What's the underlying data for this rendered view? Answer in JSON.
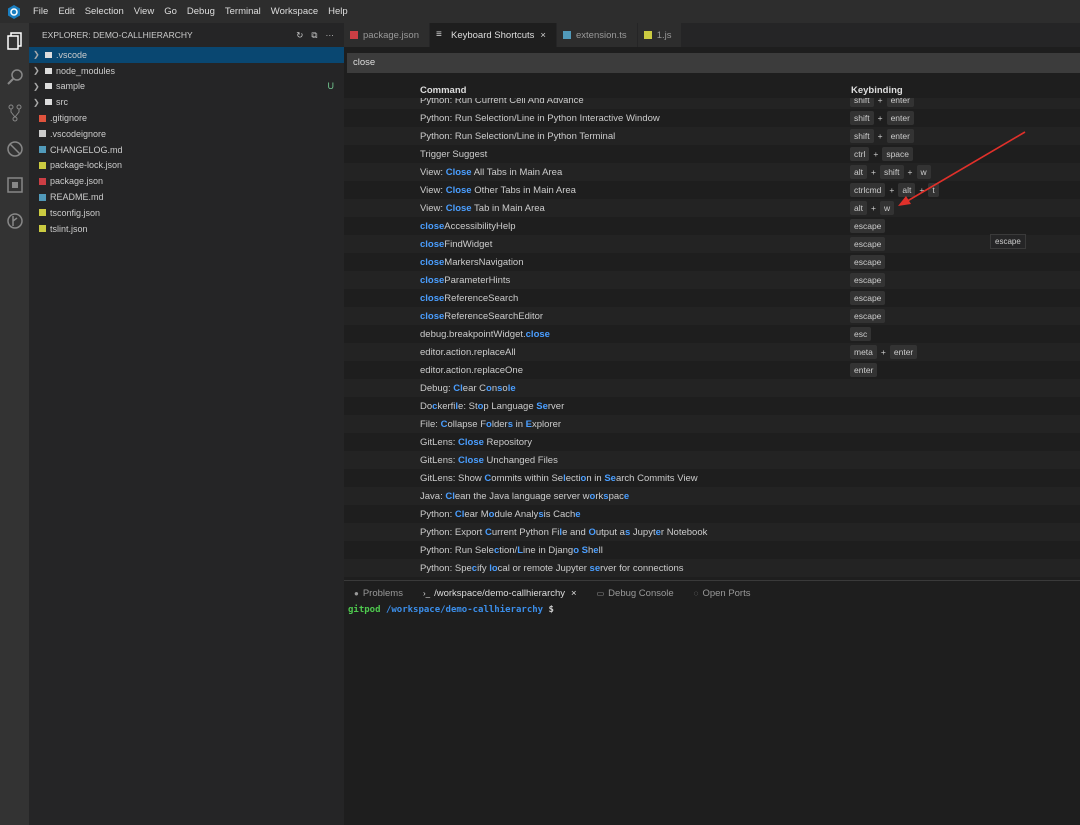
{
  "menubar": {
    "items": [
      "File",
      "Edit",
      "Selection",
      "View",
      "Go",
      "Debug",
      "Terminal",
      "Workspace",
      "Help"
    ]
  },
  "activity_bar": {
    "icons": [
      "files-icon",
      "search-icon",
      "source-control-icon",
      "debug-icon",
      "extensions-icon",
      "gitlens-icon"
    ]
  },
  "sidebar": {
    "title": "EXPLORER: DEMO-CALLHIERARCHY",
    "items": [
      {
        "label": ".vscode",
        "type": "folder",
        "selected": true
      },
      {
        "label": "node_modules",
        "type": "folder"
      },
      {
        "label": "sample",
        "type": "folder",
        "badge": "U"
      },
      {
        "label": "src",
        "type": "folder"
      },
      {
        "label": ".gitignore",
        "type": "git",
        "color": "#e0533d"
      },
      {
        "label": ".vscodeignore",
        "type": "gear",
        "color": "#cccccc"
      },
      {
        "label": "CHANGELOG.md",
        "type": "md",
        "color": "#519aba"
      },
      {
        "label": "package-lock.json",
        "type": "json",
        "color": "#cbcb41"
      },
      {
        "label": "package.json",
        "type": "npm",
        "color": "#cc3e44"
      },
      {
        "label": "README.md",
        "type": "md",
        "color": "#519aba"
      },
      {
        "label": "tsconfig.json",
        "type": "json",
        "color": "#cbcb41"
      },
      {
        "label": "tslint.json",
        "type": "json",
        "color": "#cbcb41"
      }
    ]
  },
  "tabs": [
    {
      "label": "package.json",
      "icon": "npm-icon",
      "color": "#cc3e44"
    },
    {
      "label": "Keyboard Shortcuts",
      "icon": "list-icon",
      "active": true,
      "close": "×"
    },
    {
      "label": "extension.ts",
      "icon": "typescript-icon",
      "color": "#519aba"
    },
    {
      "label": "1.js",
      "icon": "javascript-icon",
      "color": "#cbcb41"
    }
  ],
  "search": {
    "value": "close"
  },
  "table": {
    "headers": {
      "command": "Command",
      "keybinding": "Keybinding"
    },
    "rows": [
      {
        "cmd": [
          [
            "Python: Run Current Cell And Advance",
            0
          ]
        ],
        "keys": [
          "shift",
          "enter"
        ]
      },
      {
        "cmd": [
          [
            "Python: Run Selection/Line in Python Interactive Window",
            0
          ]
        ],
        "keys": [
          "shift",
          "enter"
        ]
      },
      {
        "cmd": [
          [
            "Python: Run Selection/Line in Python Terminal",
            0
          ]
        ],
        "keys": [
          "shift",
          "enter"
        ]
      },
      {
        "cmd": [
          [
            "Trigger Suggest",
            0
          ]
        ],
        "keys": [
          "ctrl",
          "space"
        ]
      },
      {
        "cmd": [
          [
            "View: ",
            0
          ],
          [
            "Close",
            1
          ],
          [
            " All Tabs in Main Area",
            0
          ]
        ],
        "keys": [
          "alt",
          "shift",
          "w"
        ]
      },
      {
        "cmd": [
          [
            "View: ",
            0
          ],
          [
            "Close",
            1
          ],
          [
            " Other Tabs in Main Area",
            0
          ]
        ],
        "keys": [
          "ctrlcmd",
          "alt",
          "t"
        ]
      },
      {
        "cmd": [
          [
            "View: ",
            0
          ],
          [
            "Close",
            1
          ],
          [
            " Tab in Main Area",
            0
          ]
        ],
        "keys": [
          "alt",
          "w"
        ]
      },
      {
        "cmd": [
          [
            "close",
            1
          ],
          [
            "AccessibilityHelp",
            0
          ]
        ],
        "keys": [
          "escape"
        ]
      },
      {
        "cmd": [
          [
            "close",
            1
          ],
          [
            "FindWidget",
            0
          ]
        ],
        "keys": [
          "escape"
        ]
      },
      {
        "cmd": [
          [
            "close",
            1
          ],
          [
            "MarkersNavigation",
            0
          ]
        ],
        "keys": [
          "escape"
        ]
      },
      {
        "cmd": [
          [
            "close",
            1
          ],
          [
            "ParameterHints",
            0
          ]
        ],
        "keys": [
          "escape"
        ]
      },
      {
        "cmd": [
          [
            "close",
            1
          ],
          [
            "ReferenceSearch",
            0
          ]
        ],
        "keys": [
          "escape"
        ]
      },
      {
        "cmd": [
          [
            "close",
            1
          ],
          [
            "ReferenceSearchEditor",
            0
          ]
        ],
        "keys": [
          "escape"
        ]
      },
      {
        "cmd": [
          [
            "debug.breakpointWidget.",
            0
          ],
          [
            "close",
            1
          ]
        ],
        "keys": [
          "esc"
        ]
      },
      {
        "cmd": [
          [
            "editor.action.replaceAll",
            0
          ]
        ],
        "keys": [
          "meta",
          "enter"
        ]
      },
      {
        "cmd": [
          [
            "editor.action.replaceOne",
            0
          ]
        ],
        "keys": [
          "enter"
        ]
      },
      {
        "cmd": [
          [
            "Debug: ",
            0
          ],
          [
            "Cl",
            1
          ],
          [
            "ear C",
            0
          ],
          [
            "o",
            1
          ],
          [
            "n",
            0
          ],
          [
            "s",
            1
          ],
          [
            "o",
            0
          ],
          [
            "le",
            1
          ]
        ],
        "keys": []
      },
      {
        "cmd": [
          [
            "Do",
            0
          ],
          [
            "c",
            1
          ],
          [
            "kerfi",
            0
          ],
          [
            "l",
            1
          ],
          [
            "e: St",
            0
          ],
          [
            "o",
            1
          ],
          [
            "p Language ",
            0
          ],
          [
            "Se",
            1
          ],
          [
            "rver",
            0
          ]
        ],
        "keys": []
      },
      {
        "cmd": [
          [
            "File: ",
            0
          ],
          [
            "C",
            1
          ],
          [
            "ollapse F",
            0
          ],
          [
            "o",
            1
          ],
          [
            "lder",
            0
          ],
          [
            "s",
            1
          ],
          [
            " in ",
            0
          ],
          [
            "E",
            1
          ],
          [
            "xplorer",
            0
          ]
        ],
        "keys": []
      },
      {
        "cmd": [
          [
            "GitLens: ",
            0
          ],
          [
            "Close",
            1
          ],
          [
            " Repository",
            0
          ]
        ],
        "keys": []
      },
      {
        "cmd": [
          [
            "GitLens: ",
            0
          ],
          [
            "Close",
            1
          ],
          [
            " Unchanged Files",
            0
          ]
        ],
        "keys": []
      },
      {
        "cmd": [
          [
            "GitLens: Show ",
            0
          ],
          [
            "C",
            1
          ],
          [
            "ommits within Se",
            0
          ],
          [
            "l",
            1
          ],
          [
            "ecti",
            0
          ],
          [
            "o",
            1
          ],
          [
            "n in ",
            0
          ],
          [
            "S",
            1
          ],
          [
            "e",
            1
          ],
          [
            "arch Commits View",
            0
          ]
        ],
        "keys": []
      },
      {
        "cmd": [
          [
            "Java: ",
            0
          ],
          [
            "Cl",
            1
          ],
          [
            "ean the Java language server w",
            0
          ],
          [
            "o",
            1
          ],
          [
            "rk",
            0
          ],
          [
            "s",
            1
          ],
          [
            "pac",
            0
          ],
          [
            "e",
            1
          ]
        ],
        "keys": []
      },
      {
        "cmd": [
          [
            "Python: ",
            0
          ],
          [
            "Cl",
            1
          ],
          [
            "ear M",
            0
          ],
          [
            "o",
            1
          ],
          [
            "dule Analy",
            0
          ],
          [
            "s",
            1
          ],
          [
            "is Cach",
            0
          ],
          [
            "e",
            1
          ]
        ],
        "keys": []
      },
      {
        "cmd": [
          [
            "Python: Export ",
            0
          ],
          [
            "C",
            1
          ],
          [
            "urrent Python Fi",
            0
          ],
          [
            "l",
            1
          ],
          [
            "e and ",
            0
          ],
          [
            "O",
            1
          ],
          [
            "utput a",
            0
          ],
          [
            "s",
            1
          ],
          [
            " Jupyt",
            0
          ],
          [
            "e",
            1
          ],
          [
            "r Notebook",
            0
          ]
        ],
        "keys": []
      },
      {
        "cmd": [
          [
            "Python: Run Sele",
            0
          ],
          [
            "c",
            1
          ],
          [
            "tion/",
            0
          ],
          [
            "L",
            1
          ],
          [
            "ine in Djang",
            0
          ],
          [
            "o",
            1
          ],
          [
            " ",
            0
          ],
          [
            "S",
            1
          ],
          [
            "h",
            0
          ],
          [
            "e",
            1
          ],
          [
            "ll",
            0
          ]
        ],
        "keys": []
      },
      {
        "cmd": [
          [
            "Python: Spe",
            0
          ],
          [
            "c",
            1
          ],
          [
            "ify ",
            0
          ],
          [
            "lo",
            1
          ],
          [
            "cal or remote Jupyter ",
            0
          ],
          [
            "se",
            1
          ],
          [
            "rver for connections",
            0
          ]
        ],
        "keys": []
      }
    ]
  },
  "tooltip": {
    "text": "escape"
  },
  "panel": {
    "tabs": [
      {
        "label": "Problems",
        "icon": "problems-icon"
      },
      {
        "label": "/workspace/demo-callhierarchy",
        "icon": "terminal-icon",
        "active": true,
        "close": "×"
      },
      {
        "label": "Debug Console",
        "icon": "debug-console-icon"
      },
      {
        "label": "Open Ports",
        "icon": "ports-icon"
      }
    ],
    "terminal": {
      "user": "gitpod",
      "path": "/workspace/demo-callhierarchy",
      "prompt": "$"
    }
  },
  "annotation": {
    "color": "#e0302a"
  }
}
